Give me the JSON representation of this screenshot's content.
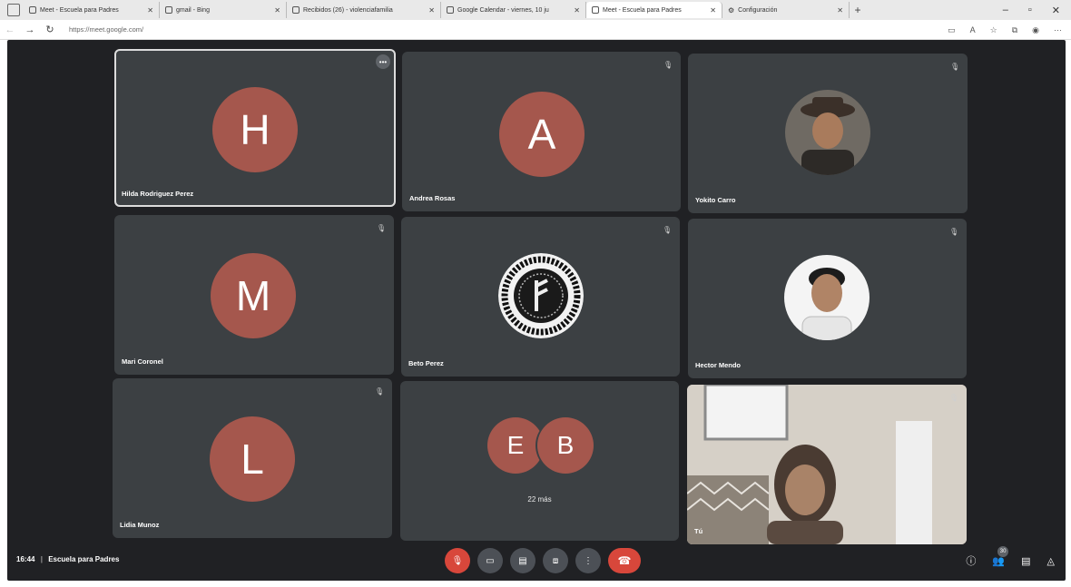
{
  "browser": {
    "tabs": [
      {
        "label": "Meet - Escuela para Padres",
        "active": false
      },
      {
        "label": "gmail - Bing",
        "active": false
      },
      {
        "label": "Recibidos (26) - violenciafamilia",
        "active": false
      },
      {
        "label": "Google Calendar - viernes, 10 ju",
        "active": false
      },
      {
        "label": "Meet - Escuela para Padres",
        "active": true
      },
      {
        "label": "Configuración",
        "active": false
      }
    ],
    "url": "https://meet.google.com/"
  },
  "tiles": [
    {
      "name": "Hilda Rodriguez Perez",
      "initial": "H",
      "kind": "initial"
    },
    {
      "name": "Andrea Rosas",
      "initial": "A",
      "kind": "initial"
    },
    {
      "name": "Yokito Carro",
      "initial": "",
      "kind": "photo"
    },
    {
      "name": "Mari Coronel",
      "initial": "M",
      "kind": "initial"
    },
    {
      "name": "Beto Perez",
      "initial": "",
      "kind": "emblem"
    },
    {
      "name": "Hector Mendo",
      "initial": "",
      "kind": "photo"
    },
    {
      "name": "Lidia Munoz",
      "initial": "L",
      "kind": "initial"
    },
    {
      "name": "",
      "initial": "",
      "kind": "group",
      "initials": [
        "E",
        "B"
      ],
      "more": "22 más"
    },
    {
      "name": "Tú",
      "initial": "",
      "kind": "self"
    }
  ],
  "meeting": {
    "time": "16:44",
    "separator": "|",
    "title": "Escuela para Padres",
    "participants_badge": "30"
  },
  "colors": {
    "stage": "#202124",
    "tile": "#3c4043",
    "avatar": "#a5574d",
    "end_call": "#d8473b"
  }
}
